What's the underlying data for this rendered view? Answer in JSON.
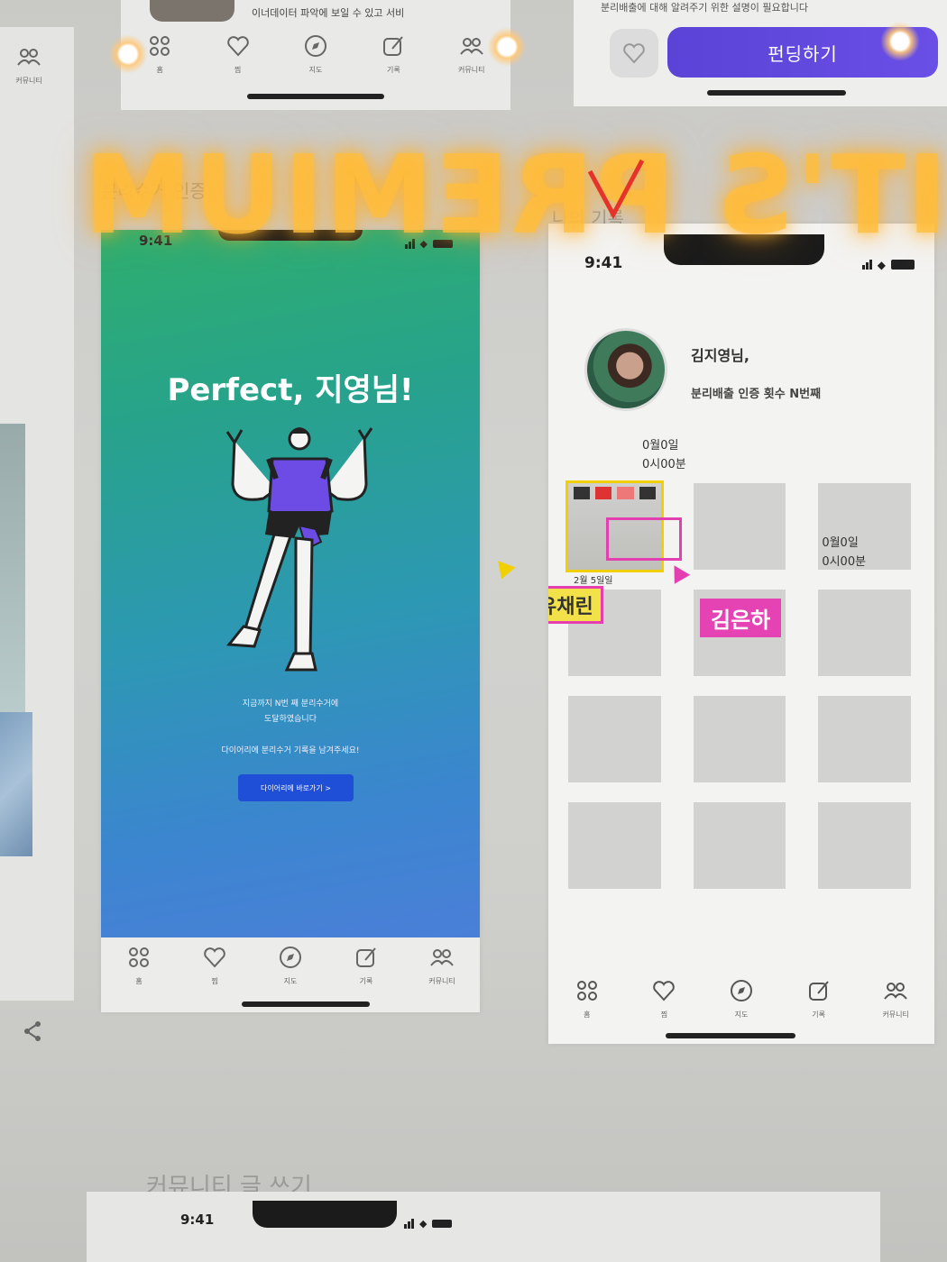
{
  "top_left_frame": {
    "caption": "이너데이터 파악에 보일 수 있고 서비",
    "tabs": [
      {
        "icon": "home-grid-icon",
        "label": "홈"
      },
      {
        "icon": "heart-icon",
        "label": "찜"
      },
      {
        "icon": "compass-icon",
        "label": "지도"
      },
      {
        "icon": "edit-icon",
        "label": "기록"
      },
      {
        "icon": "community-icon",
        "label": "커뮤니티"
      }
    ]
  },
  "top_right_frame": {
    "caption": "분리배출에 대해 알려주기 위한 설명이 필요합니다",
    "fund_button": "펀딩하기"
  },
  "left_edge_frame": {
    "tab_label": "커뮤니티"
  },
  "neon_sign": {
    "text": "IT'S PREMIUM"
  },
  "sections": {
    "left": "분리수거 인증",
    "right": "나의 기록",
    "bottom": "커뮤니티 글 쓰기"
  },
  "main_phone": {
    "time": "9:41",
    "title": "Perfect, 지영님!",
    "message_line1": "지금까지 N번 째 분리수거에",
    "message_line2": "도달하였습니다",
    "message_line3": "다이어리에 분리수거 기록을 남겨주세요!",
    "cta": "다이어리에 바로가기 >",
    "tabs": [
      {
        "icon": "home-grid-icon",
        "label": "홈"
      },
      {
        "icon": "heart-icon",
        "label": "찜"
      },
      {
        "icon": "compass-icon",
        "label": "지도"
      },
      {
        "icon": "edit-icon",
        "label": "기록"
      },
      {
        "icon": "community-icon",
        "label": "커뮤니티"
      }
    ]
  },
  "profile_phone": {
    "time": "9:41",
    "name": "김지영님,",
    "cert_count": "분리배출 인증 횟수 N번째",
    "latest_date": "0월0일",
    "latest_time": "0시00분",
    "featured_caption": "2월 5일일",
    "cell_date": "0월0일",
    "cell_time": "0시00분",
    "tag_yellow": "유채린",
    "tag_pink": "김은하",
    "tabs": [
      {
        "icon": "home-grid-icon",
        "label": "홈"
      },
      {
        "icon": "heart-icon",
        "label": "찜"
      },
      {
        "icon": "compass-icon",
        "label": "지도"
      },
      {
        "icon": "edit-icon",
        "label": "기록"
      },
      {
        "icon": "community-icon",
        "label": "커뮤니티"
      }
    ]
  },
  "bottom_frame": {
    "time": "9:41"
  },
  "colors": {
    "accent_purple": "#5a43d6",
    "hero_green": "#2fae6e",
    "hero_blue": "#4a7fd8",
    "annotation_yellow": "#f3e14a",
    "annotation_pink": "#e542b4"
  }
}
